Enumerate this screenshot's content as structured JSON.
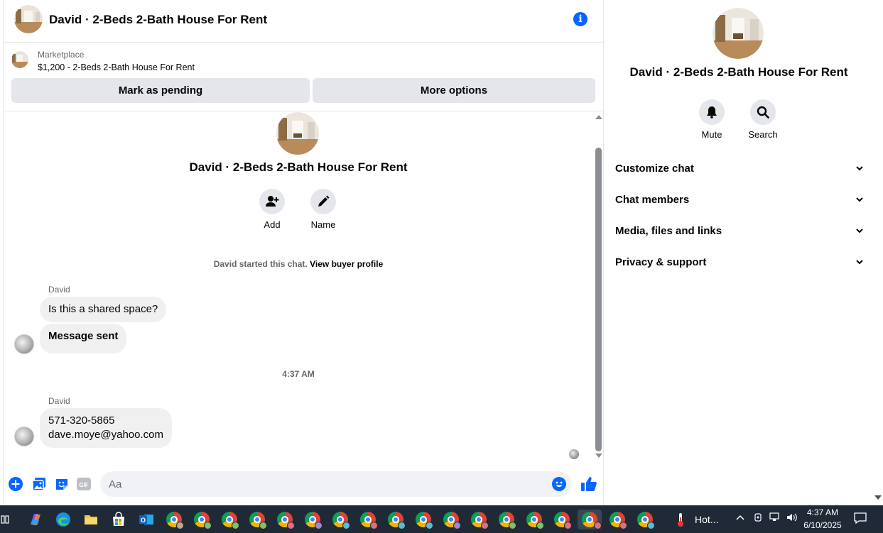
{
  "header": {
    "title": "David · 2-Beds 2-Bath House For Rent",
    "info_icon": "info-icon"
  },
  "marketplace": {
    "label": "Marketplace",
    "listing": "$1,200 - 2-Beds 2-Bath House For Rent",
    "pending_button": "Mark as pending",
    "more_button": "More options"
  },
  "intro": {
    "title": "David · 2-Beds 2-Bath House For Rent",
    "actions": [
      {
        "label": "Add",
        "icon": "add-person-icon"
      },
      {
        "label": "Name",
        "icon": "pencil-icon"
      }
    ],
    "started_text": "David started this chat.",
    "buyer_profile_link": "View buyer profile"
  },
  "messages": {
    "group1": {
      "sender": "David",
      "bubble1": "Is this a shared space?",
      "bubble2": "Message sent"
    },
    "timestamp": "4:37 AM",
    "group2": {
      "sender": "David",
      "phone": "571-320-5865",
      "email": "dave.moye@yahoo.com"
    }
  },
  "composer": {
    "placeholder": "Aa",
    "icons": [
      "plus-icon",
      "photo-icon",
      "sticker-icon",
      "gif-icon",
      "emoji-icon",
      "thumbs-up-icon"
    ],
    "gif_label": "GIF"
  },
  "details": {
    "title": "David · 2-Beds 2-Bath House For Rent",
    "actions": [
      {
        "label": "Mute",
        "icon": "bell-icon"
      },
      {
        "label": "Search",
        "icon": "search-icon"
      }
    ],
    "sections": [
      "Customize chat",
      "Chat members",
      "Media, files and links",
      "Privacy & support"
    ]
  },
  "taskbar": {
    "weather": "Hot...",
    "time": "4:37 AM",
    "date": "6/10/2025"
  },
  "colors": {
    "accent": "#0866ff",
    "bubble": "#f0f0f0",
    "button": "#e4e6eb",
    "taskbar": "#1f2a36"
  }
}
